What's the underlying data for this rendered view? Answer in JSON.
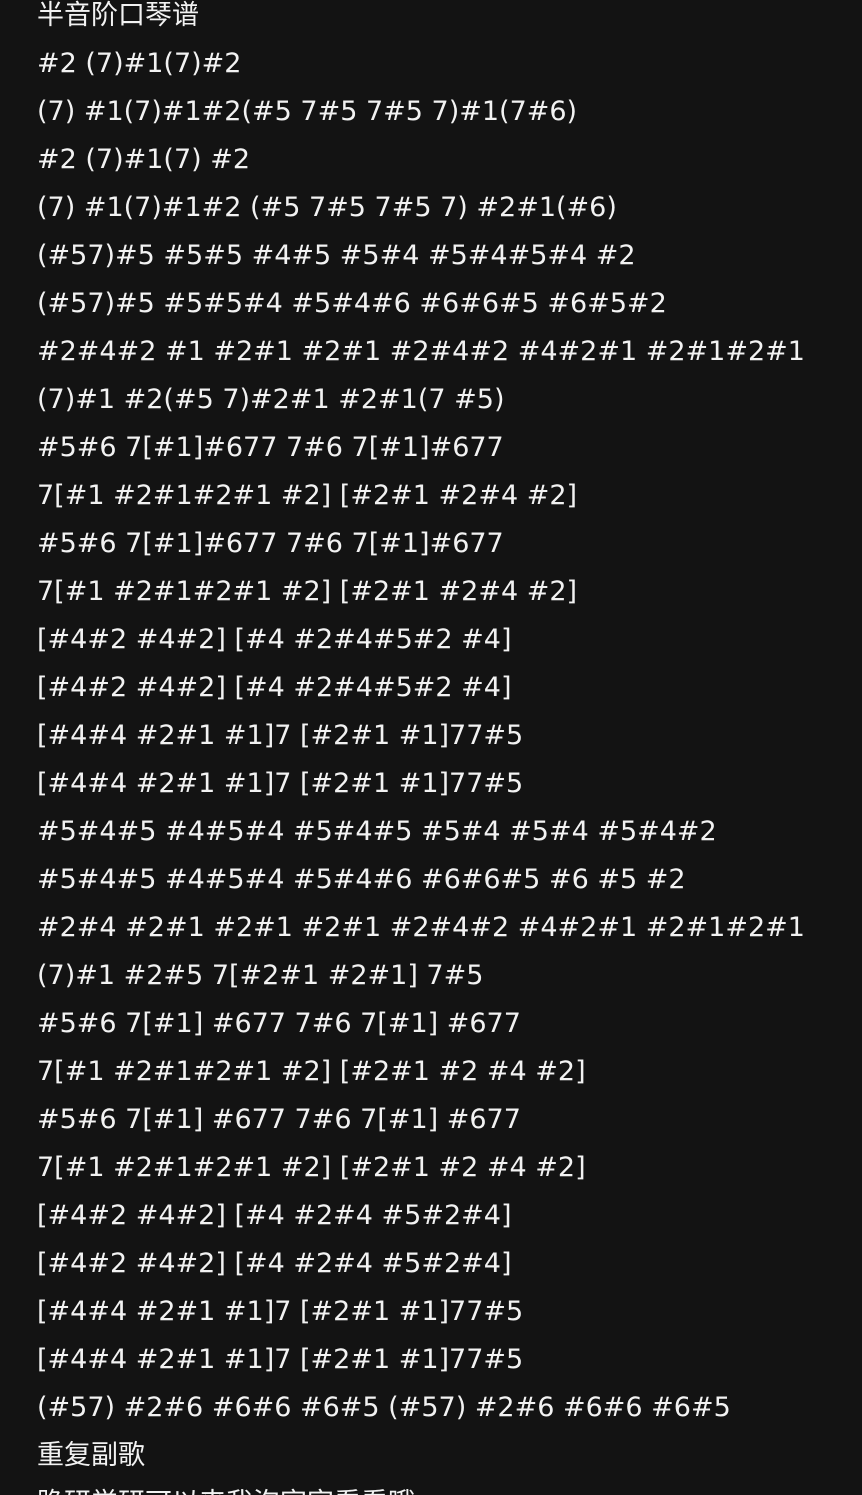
{
  "document": {
    "lines": [
      "半音阶口琴谱",
      "#2 (7)#1(7)#2",
      "(7) #1(7)#1#2(#5 7#5 7#5 7)#1(7#6)",
      "#2 (7)#1(7) #2",
      "(7) #1(7)#1#2 (#5 7#5 7#5 7) #2#1(#6)",
      "(#57)#5 #5#5 #4#5 #5#4 #5#4#5#4 #2",
      "(#57)#5 #5#5#4 #5#4#6 #6#6#5 #6#5#2",
      "#2#4#2 #1 #2#1 #2#1 #2#4#2 #4#2#1 #2#1#2#1",
      "(7)#1 #2(#5 7)#2#1 #2#1(7 #5)",
      "#5#6 7[#1]#677 7#6 7[#1]#677",
      "7[#1 #2#1#2#1 #2] [#2#1 #2#4 #2]",
      "#5#6 7[#1]#677 7#6 7[#1]#677",
      "7[#1 #2#1#2#1 #2] [#2#1 #2#4 #2]",
      "[#4#2 #4#2] [#4 #2#4#5#2 #4]",
      "[#4#2 #4#2] [#4 #2#4#5#2 #4]",
      "[#4#4 #2#1 #1]7 [#2#1 #1]77#5",
      "[#4#4 #2#1 #1]7 [#2#1 #1]77#5",
      "#5#4#5 #4#5#4 #5#4#5 #5#4 #5#4 #5#4#2",
      "#5#4#5 #4#5#4 #5#4#6 #6#6#5 #6 #5 #2",
      "#2#4 #2#1 #2#1 #2#1 #2#4#2 #4#2#1 #2#1#2#1",
      "(7)#1 #2#5 7[#2#1 #2#1] 7#5",
      "#5#6 7[#1] #677 7#6 7[#1] #677",
      "7[#1 #2#1#2#1 #2] [#2#1 #2 #4 #2]",
      "#5#6 7[#1] #677 7#6 7[#1] #677",
      "7[#1 #2#1#2#1 #2] [#2#1 #2 #4 #2]",
      "[#4#2 #4#2] [#4 #2#4 #5#2#4]",
      "[#4#2 #4#2] [#4 #2#4 #5#2#4]",
      "[#4#4 #2#1 #1]7 [#2#1 #1]77#5",
      "[#4#4 #2#1 #1]7 [#2#1 #1]77#5",
      "(#57) #2#6 #6#6 #6#5 (#57) #2#6 #6#6 #6#5",
      "重复副歌",
      "跪研学研可以来我泡字字看看哦"
    ]
  },
  "colors": {
    "background": "#131313",
    "text": "#f2f2f2"
  }
}
